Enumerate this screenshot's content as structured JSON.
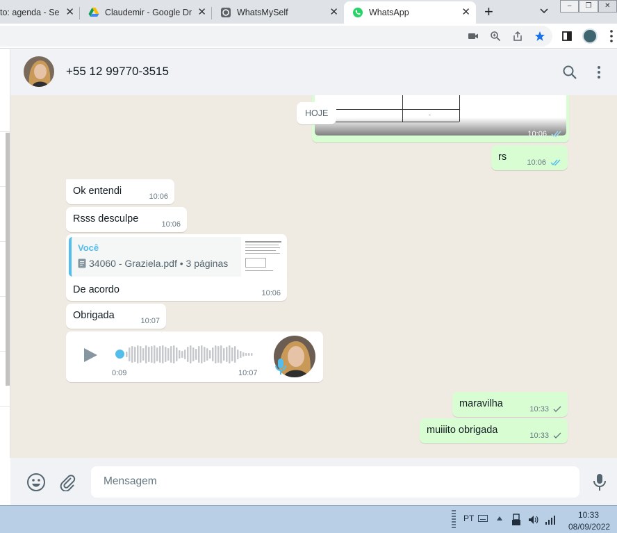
{
  "browser": {
    "tabs": [
      {
        "title": "to: agenda - Ser",
        "active": false
      },
      {
        "title": "Claudemir - Google Driv",
        "active": false
      },
      {
        "title": "WhatsMySelf",
        "active": false
      },
      {
        "title": "WhatsApp",
        "active": true
      }
    ],
    "new_tab": "+",
    "toolbar_icons": [
      "camera-icon",
      "zoom-icon",
      "share-icon",
      "bookmark-star-icon",
      "sidepanel-icon",
      "profile-avatar",
      "menu-icon"
    ]
  },
  "chat": {
    "contact_name": "+55 12 99770-3515",
    "date_chip": "HOJE",
    "table_cell": "-",
    "messages": [
      {
        "dir": "out",
        "type": "image",
        "time": "10:06",
        "status": "read"
      },
      {
        "dir": "out",
        "text": "rs",
        "time": "10:06",
        "status": "read"
      },
      {
        "dir": "in",
        "text": "Ok entendi",
        "time": "10:06"
      },
      {
        "dir": "in",
        "text": "Rsss desculpe",
        "time": "10:06"
      },
      {
        "dir": "in",
        "type": "reply",
        "quote_author": "Você",
        "quote_doc": "34060 - Graziela.pdf • 3 páginas",
        "text": "De acordo",
        "time": "10:06"
      },
      {
        "dir": "in",
        "text": "Obrigada",
        "time": "10:07"
      },
      {
        "dir": "in",
        "type": "audio",
        "duration": "0:09",
        "time": "10:07",
        "progress": 0
      },
      {
        "dir": "out",
        "text": "maravilha",
        "time": "10:33",
        "status": "sent"
      },
      {
        "dir": "out",
        "text": "muiiito obrigada",
        "time": "10:33",
        "status": "sent"
      }
    ],
    "input_placeholder": "Mensagem"
  },
  "taskbar": {
    "language": "PT",
    "time": "10:33",
    "date": "08/09/2022"
  },
  "colors": {
    "header_bg": "#f0f2f5",
    "chat_bg": "#efeae2",
    "outgoing_bubble": "#d9fdd3",
    "read_tick": "#53bdeb",
    "accent": "#00a884"
  }
}
